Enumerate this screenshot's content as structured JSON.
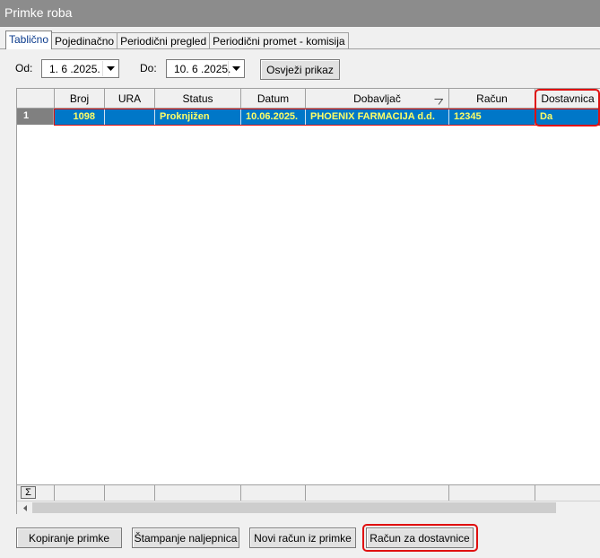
{
  "window": {
    "title": "Primke roba"
  },
  "tabs": [
    {
      "label": "Tablično",
      "active": true
    },
    {
      "label": "Pojedinačno",
      "active": false
    },
    {
      "label": "Periodični pregled",
      "active": false
    },
    {
      "label": "Periodični promet - komisija",
      "active": false
    }
  ],
  "filter": {
    "from_label": "Od:",
    "from_value": "1. 6 .2025.",
    "to_label": "Do:",
    "to_value": "10. 6 .2025.",
    "refresh_label": "Osvježi prikaz"
  },
  "grid": {
    "columns": [
      "Broj",
      "URA",
      "Status",
      "Datum",
      "Dobavljač",
      "Račun",
      "Dostavnica"
    ],
    "sort_indicator_icon": "sort-indicator-icon",
    "rows": [
      {
        "index": "1",
        "broj": "1098",
        "ura": "",
        "status": "Proknjižen",
        "datum": "10.06.2025.",
        "dobavljac": "PHOENIX FARMACIJA d.d.",
        "racun": "12345",
        "dostavnica": "Da"
      }
    ],
    "sum_symbol": "Σ"
  },
  "buttons": {
    "copy": "Kopiranje primke",
    "print_labels": "Štampanje naljepnica",
    "new_invoice": "Novi račun iz primke",
    "invoice_for_delivery": "Račun za dostavnice"
  },
  "colors": {
    "selected_row_bg": "#0077c8",
    "selected_row_text": "#ffff66",
    "highlight": "#e01010"
  }
}
